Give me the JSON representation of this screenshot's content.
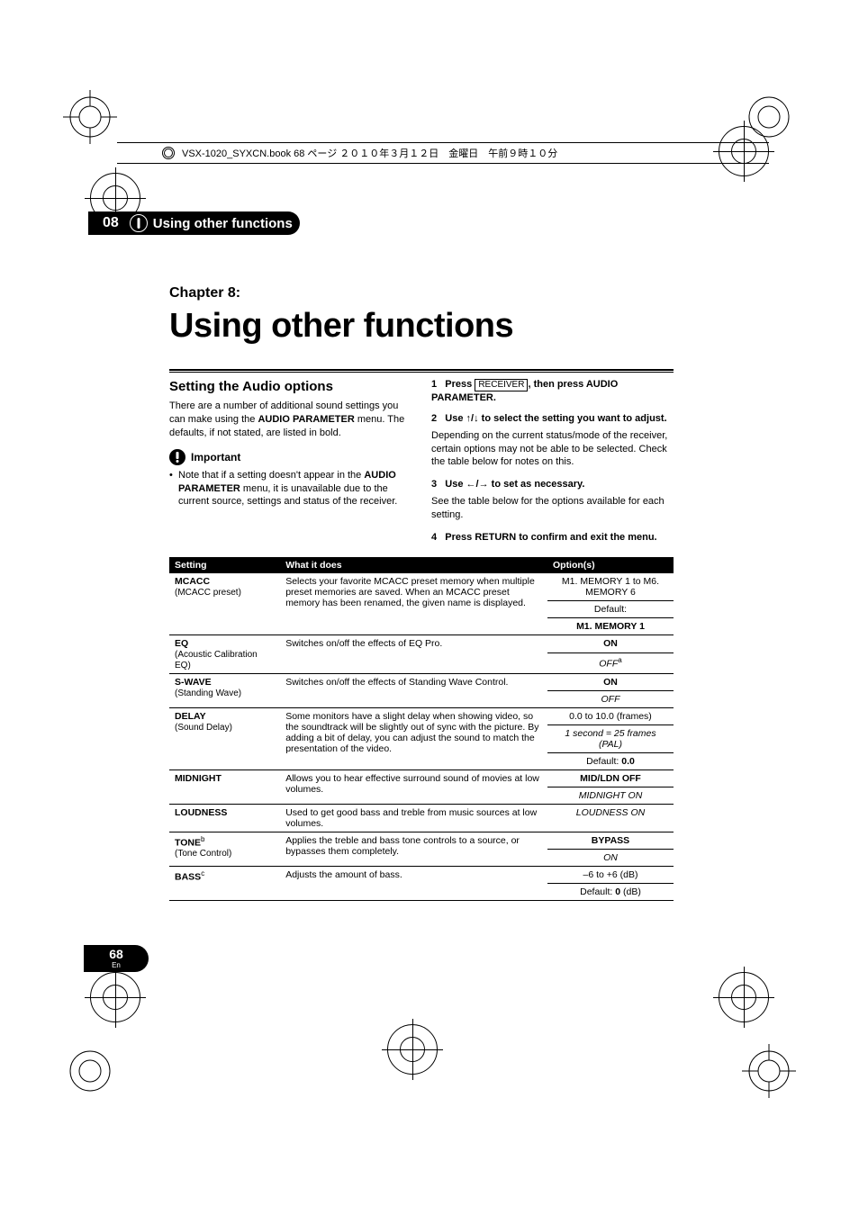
{
  "topbar": {
    "filename": "VSX-1020_SYXCN.book  68 ページ  ２０１０年３月１２日　金曜日　午前９時１０分"
  },
  "header": {
    "section_number": "08",
    "section_title": "Using other functions"
  },
  "chapter": {
    "label": "Chapter 8:",
    "title": "Using other functions"
  },
  "left": {
    "h2": "Setting the Audio options",
    "intro_a": "There are a number of additional sound settings you can make using the ",
    "intro_bold": "AUDIO PARAMETER",
    "intro_b": " menu. The defaults, if not stated, are listed in bold.",
    "important_label": "Important",
    "bullet_a": "Note that if a setting doesn't appear in the ",
    "bullet_bold": "AUDIO PARAMETER",
    "bullet_b": " menu, it is unavailable due to the current source, settings and status of the receiver."
  },
  "right": {
    "step1_num": "1",
    "step1_a": "Press ",
    "step1_box": "RECEIVER",
    "step1_b": ", then press AUDIO PARAMETER.",
    "step2_num": "2",
    "step2_a": "Use ",
    "step2_arrows": "↑/↓",
    "step2_b": " to select the setting you want to adjust.",
    "step2_note": "Depending on the current status/mode of the receiver, certain options may not be able to be selected. Check the table below for notes on this.",
    "step3_num": "3",
    "step3_a": "Use ",
    "step3_arrows": "←/→",
    "step3_b": " to set as necessary.",
    "step3_note": "See the table below for the options available for each setting.",
    "step4_num": "4",
    "step4_text": "Press RETURN to confirm and exit the menu."
  },
  "table": {
    "headers": {
      "c1": "Setting",
      "c2": "What it does",
      "c3": "Option(s)"
    },
    "rows": [
      {
        "name": "MCACC",
        "sub": "(MCACC preset)",
        "desc": "Selects your favorite MCACC preset memory when multiple preset memories are saved. When an MCACC preset memory has been renamed, the given name is displayed.",
        "opts": [
          {
            "text": "M1. MEMORY 1 to M6. MEMORY 6",
            "style": "plain"
          },
          {
            "text": "Default:",
            "style": "plain_inline"
          },
          {
            "text": "M1. MEMORY 1",
            "style": "bold"
          }
        ]
      },
      {
        "name": "EQ",
        "sub": "(Acoustic Calibration EQ)",
        "desc": "Switches on/off the effects of EQ Pro.",
        "opts": [
          {
            "text": "ON",
            "style": "bold"
          },
          {
            "text": "OFF",
            "style": "ital",
            "sup": "a"
          }
        ]
      },
      {
        "name": "S-WAVE",
        "sub": "(Standing Wave)",
        "desc": "Switches on/off the effects of Standing Wave Control.",
        "opts": [
          {
            "text": "ON",
            "style": "bold"
          },
          {
            "text": "OFF",
            "style": "ital"
          }
        ]
      },
      {
        "name": "DELAY",
        "sub": "(Sound Delay)",
        "desc": "Some monitors have a slight delay when showing video, so the soundtrack will be slightly out of sync with the picture. By adding a bit of delay, you can adjust the sound to match the presentation of the video.",
        "opts": [
          {
            "text": "0.0 to 10.0 (frames)",
            "style": "plain"
          },
          {
            "text": "1 second = 25 frames (PAL)",
            "style": "ital"
          },
          {
            "text_a": "Default: ",
            "text_b": "0.0",
            "style": "default_bold"
          }
        ]
      },
      {
        "name": "MIDNIGHT",
        "sub": "",
        "desc": "Allows you to hear effective surround sound of movies at low volumes.",
        "opts": [
          {
            "text": "MID/LDN OFF",
            "style": "bold"
          },
          {
            "text": "MIDNIGHT ON",
            "style": "ital"
          }
        ],
        "shared_below": true
      },
      {
        "name": "LOUDNESS",
        "sub": "",
        "desc": "Used to get good bass and treble from music sources at low volumes.",
        "opts": [
          {
            "text": "LOUDNESS ON",
            "style": "ital"
          }
        ]
      },
      {
        "name": "TONE",
        "name_sup": "b",
        "sub": "(Tone Control)",
        "desc": "Applies the treble and bass tone controls to a source, or bypasses them completely.",
        "opts": [
          {
            "text": "BYPASS",
            "style": "bold"
          },
          {
            "text": "ON",
            "style": "ital"
          }
        ]
      },
      {
        "name": "BASS",
        "name_sup": "c",
        "sub": "",
        "desc": "Adjusts the amount of bass.",
        "opts": [
          {
            "text": "–6 to +6 (dB)",
            "style": "plain"
          },
          {
            "text_a": "Default: ",
            "text_b": "0",
            "text_c": " (dB)",
            "style": "default_bold_unit"
          }
        ]
      }
    ]
  },
  "footer": {
    "page": "68",
    "lang": "En"
  }
}
